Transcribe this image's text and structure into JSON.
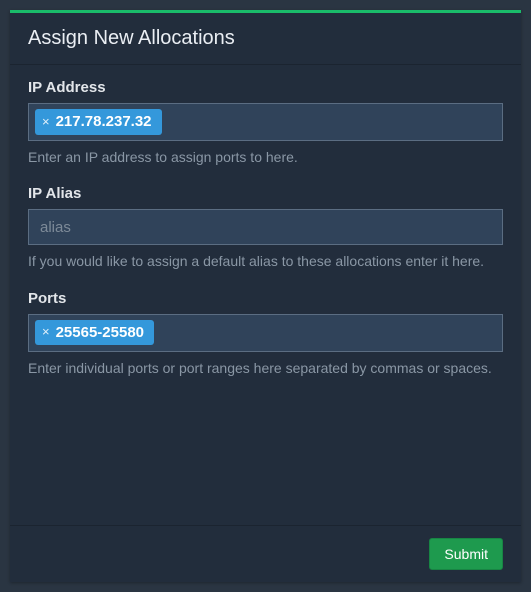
{
  "panel": {
    "title": "Assign New Allocations"
  },
  "ip_address": {
    "label": "IP Address",
    "tags": [
      "217.78.237.32"
    ],
    "help": "Enter an IP address to assign ports to here."
  },
  "ip_alias": {
    "label": "IP Alias",
    "placeholder": "alias",
    "value": "",
    "help": "If you would like to assign a default alias to these allocations enter it here."
  },
  "ports": {
    "label": "Ports",
    "tags": [
      "25565-25580"
    ],
    "help": "Enter individual ports or port ranges here separated by commas or spaces."
  },
  "footer": {
    "submit_label": "Submit"
  },
  "icons": {
    "tag_remove": "×"
  }
}
